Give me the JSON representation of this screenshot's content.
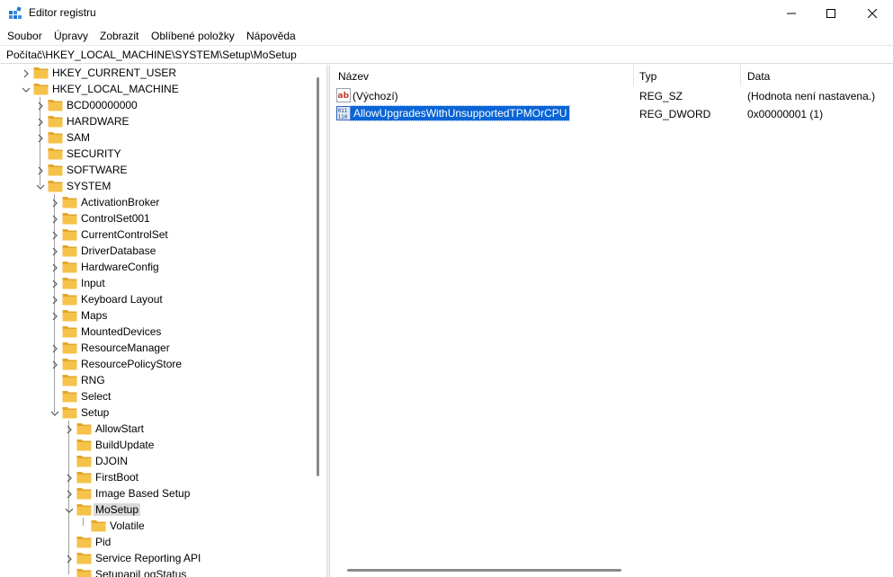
{
  "window": {
    "title": "Editor registru",
    "controls": {
      "minimize": "minimize",
      "maximize": "maximize",
      "close": "close"
    }
  },
  "menu": [
    "Soubor",
    "Úpravy",
    "Zobrazit",
    "Oblíbené položky",
    "Nápověda"
  ],
  "address": "Počítač\\HKEY_LOCAL_MACHINE\\SYSTEM\\Setup\\MoSetup",
  "tree": [
    {
      "label": "HKEY_CURRENT_USER",
      "level": 0,
      "expand": "collapsed"
    },
    {
      "label": "HKEY_LOCAL_MACHINE",
      "level": 0,
      "expand": "expanded"
    },
    {
      "label": "BCD00000000",
      "level": 1,
      "expand": "collapsed"
    },
    {
      "label": "HARDWARE",
      "level": 1,
      "expand": "collapsed"
    },
    {
      "label": "SAM",
      "level": 1,
      "expand": "collapsed"
    },
    {
      "label": "SECURITY",
      "level": 1,
      "expand": "none"
    },
    {
      "label": "SOFTWARE",
      "level": 1,
      "expand": "collapsed"
    },
    {
      "label": "SYSTEM",
      "level": 1,
      "expand": "expanded"
    },
    {
      "label": "ActivationBroker",
      "level": 2,
      "expand": "collapsed"
    },
    {
      "label": "ControlSet001",
      "level": 2,
      "expand": "collapsed"
    },
    {
      "label": "CurrentControlSet",
      "level": 2,
      "expand": "collapsed"
    },
    {
      "label": "DriverDatabase",
      "level": 2,
      "expand": "collapsed"
    },
    {
      "label": "HardwareConfig",
      "level": 2,
      "expand": "collapsed"
    },
    {
      "label": "Input",
      "level": 2,
      "expand": "collapsed"
    },
    {
      "label": "Keyboard Layout",
      "level": 2,
      "expand": "collapsed"
    },
    {
      "label": "Maps",
      "level": 2,
      "expand": "collapsed"
    },
    {
      "label": "MountedDevices",
      "level": 2,
      "expand": "none"
    },
    {
      "label": "ResourceManager",
      "level": 2,
      "expand": "collapsed"
    },
    {
      "label": "ResourcePolicyStore",
      "level": 2,
      "expand": "collapsed"
    },
    {
      "label": "RNG",
      "level": 2,
      "expand": "none"
    },
    {
      "label": "Select",
      "level": 2,
      "expand": "none"
    },
    {
      "label": "Setup",
      "level": 2,
      "expand": "expanded"
    },
    {
      "label": "AllowStart",
      "level": 3,
      "expand": "collapsed"
    },
    {
      "label": "BuildUpdate",
      "level": 3,
      "expand": "none"
    },
    {
      "label": "DJOIN",
      "level": 3,
      "expand": "none"
    },
    {
      "label": "FirstBoot",
      "level": 3,
      "expand": "collapsed"
    },
    {
      "label": "Image Based Setup",
      "level": 3,
      "expand": "collapsed"
    },
    {
      "label": "MoSetup",
      "level": 3,
      "expand": "expanded",
      "selected": true
    },
    {
      "label": "Volatile",
      "level": 4,
      "expand": "none"
    },
    {
      "label": "Pid",
      "level": 3,
      "expand": "none"
    },
    {
      "label": "Service Reporting API",
      "level": 3,
      "expand": "collapsed"
    },
    {
      "label": "SetupapiLogStatus",
      "level": 3,
      "expand": "none"
    }
  ],
  "list": {
    "headers": {
      "name": "Název",
      "type": "Typ",
      "data": "Data"
    },
    "rows": [
      {
        "icon": "string-value-icon",
        "name": "(Výchozí)",
        "type": "REG_SZ",
        "data": "(Hodnota není nastavena.)",
        "selected": false
      },
      {
        "icon": "binary-value-icon",
        "name": "AllowUpgradesWithUnsupportedTPMOrCPU",
        "type": "REG_DWORD",
        "data": "0x00000001 (1)",
        "selected": true
      }
    ]
  },
  "colors": {
    "folder": "#f5c24a",
    "folder_dark": "#e2a72a",
    "selection": "#0a64d6",
    "tree_selection": "#d9d9d9"
  }
}
